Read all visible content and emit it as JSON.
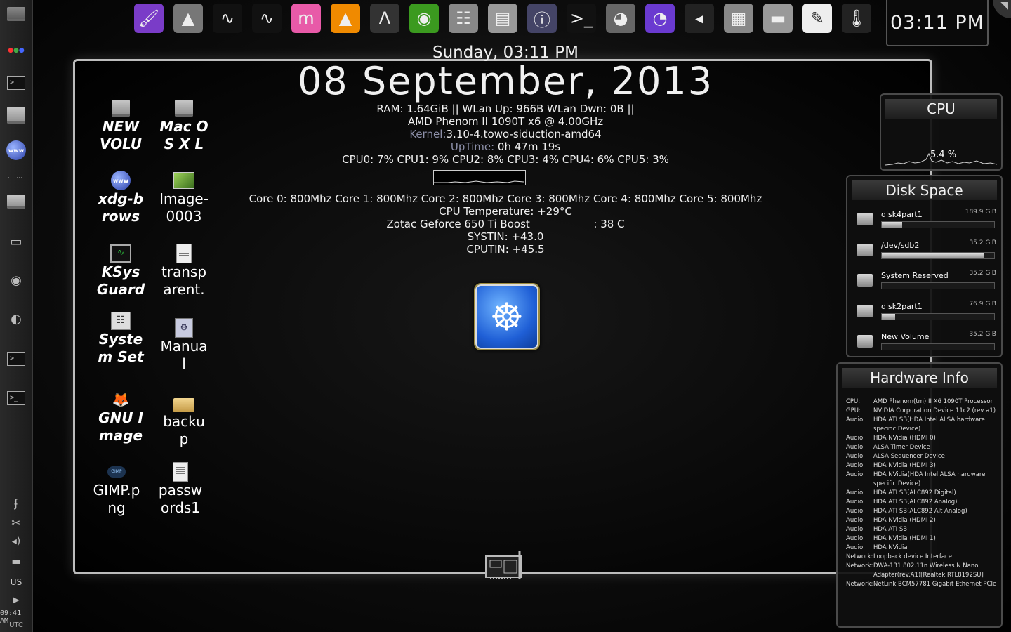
{
  "clock": {
    "time": "03:11 PM"
  },
  "conky": {
    "day_time": "Sunday, 03:11 PM",
    "date": "08 September, 2013",
    "net_line": "RAM: 1.64GiB  ||  WLan Up: 966B   WLan Dwn: 0B   ||",
    "cpu_model": "AMD Phenom II 1090T x6 @ 4.00GHz",
    "kernel_label": "Kernel:",
    "kernel_value": "3.10-4.towo-siduction-amd64",
    "uptime_label": "UpTime:",
    "uptime_value": "0h 47m 19s",
    "cpu_usage_line": "CPU0: 7%   CPU1: 9%   CPU2: 8%   CPU3: 4%   CPU4: 6%   CPU5: 3%",
    "core_freq_line": "Core 0: 800Mhz Core 1: 800Mhz Core 2: 800Mhz Core 3: 800Mhz Core 4: 800Mhz Core 5: 800Mhz",
    "cpu_temp_line": "CPU Temperature:  +29°C",
    "gpu_line": "Zotac Geforce 650 Ti Boost                   : 38 C",
    "systin_line": "SYSTIN: +43.0",
    "cputin_line": "CPUTIN: +45.5"
  },
  "desktop_icons": [
    {
      "label": "NEW VOLUM",
      "icon": "drive-icon"
    },
    {
      "label": "Mac OS X L",
      "icon": "drive-icon"
    },
    {
      "label": "xdg-brows",
      "icon": "www-icon"
    },
    {
      "label": "Image-0003",
      "icon": "image-icon"
    },
    {
      "label": "KSysGuard",
      "icon": "monitor-icon"
    },
    {
      "label": "transparent.c",
      "icon": "document-icon"
    },
    {
      "label": "System Sett",
      "icon": "settings-icon"
    },
    {
      "label": "Manual",
      "icon": "manual-icon"
    },
    {
      "label": "GNU Image",
      "icon": "gimp-icon"
    },
    {
      "label": "backup",
      "icon": "folder-icon"
    },
    {
      "label": "GIMP.png",
      "icon": "png-icon"
    },
    {
      "label": "passwords1",
      "icon": "document-icon"
    }
  ],
  "left_panel": {
    "keyboard_layout": "US",
    "time": "09:41 AM",
    "timezone": "UTC"
  },
  "cpu_widget": {
    "title": "CPU",
    "percent": "5.4 %"
  },
  "disk_widget": {
    "title": "Disk Space",
    "disks": [
      {
        "name": "disk4part1",
        "size": "189.9 GiB",
        "used_fraction": 0.18
      },
      {
        "name": "/dev/sdb2",
        "size": "35.2 GiB",
        "used_fraction": 0.91
      },
      {
        "name": "System Reserved",
        "size": "35.2 GiB",
        "used_fraction": 0.0
      },
      {
        "name": "disk2part1",
        "size": "76.9 GiB",
        "used_fraction": 0.12
      },
      {
        "name": "New Volume",
        "size": "35.2 GiB",
        "used_fraction": 0.0
      }
    ]
  },
  "hardware_widget": {
    "title": "Hardware Info",
    "rows": [
      {
        "k": "CPU:",
        "v": "AMD Phenom(tm) II X6 1090T Processor"
      },
      {
        "k": "GPU:",
        "v": "NVIDIA Corporation Device 11c2 (rev a1)"
      },
      {
        "k": "Audio:",
        "v": "HDA ATI SB(HDA Intel ALSA hardware specific Device)"
      },
      {
        "k": "Audio:",
        "v": "HDA NVidia (HDMI 0)"
      },
      {
        "k": "Audio:",
        "v": "ALSA Timer Device"
      },
      {
        "k": "Audio:",
        "v": "ALSA Sequencer Device"
      },
      {
        "k": "Audio:",
        "v": "HDA NVidia (HDMI 3)"
      },
      {
        "k": "Audio:",
        "v": "HDA NVidia(HDA Intel ALSA hardware specific Device)"
      },
      {
        "k": "Audio:",
        "v": "HDA ATI SB(ALC892 Digital)"
      },
      {
        "k": "Audio:",
        "v": "HDA ATI SB(ALC892 Analog)"
      },
      {
        "k": "Audio:",
        "v": "HDA ATI SB(ALC892 Alt Analog)"
      },
      {
        "k": "Audio:",
        "v": "HDA NVidia (HDMI 2)"
      },
      {
        "k": "Audio:",
        "v": "HDA ATI SB"
      },
      {
        "k": "Audio:",
        "v": "HDA NVidia (HDMI 1)"
      },
      {
        "k": "Audio:",
        "v": "HDA NVidia"
      },
      {
        "k": "Network:",
        "v": "Loopback device Interface"
      },
      {
        "k": "Network:",
        "v": "DWA-131 802.11n Wireless N Nano Adapter(rev.A1)[Realtek RTL8192SU]"
      },
      {
        "k": "Network:",
        "v": "NetLink BCM57781 Gigabit Ethernet PCIe"
      }
    ]
  },
  "launcher": [
    "krita-icon",
    "inkscape-icon",
    "ksysguard-icon",
    "system-monitor-icon",
    "mendeley-icon",
    "vlc-icon",
    "arch-icon",
    "nvidia-icon",
    "mixer-icon",
    "file-cabinet-icon",
    "hardware-info-icon",
    "terminal-icon",
    "firefox-icon",
    "torrent-icon",
    "volume-icon",
    "calculator-icon",
    "disk-icon",
    "editor-icon",
    "thermometer-icon"
  ]
}
